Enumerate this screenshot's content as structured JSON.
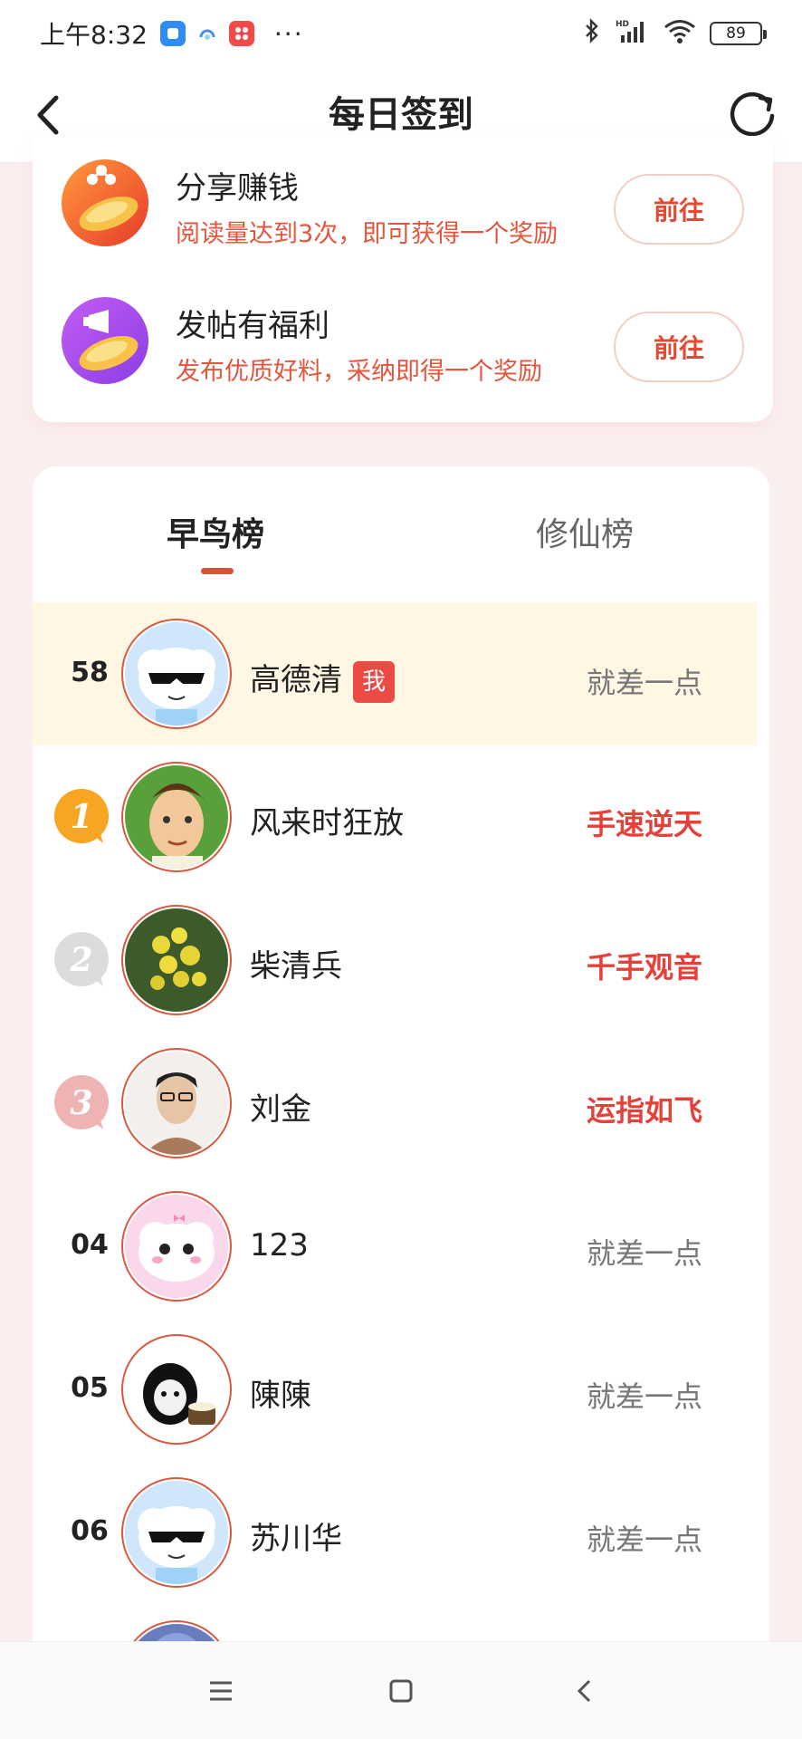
{
  "status_bar": {
    "time": "上午8:32",
    "battery": "89",
    "more": "···"
  },
  "header": {
    "title": "每日签到"
  },
  "tasks": [
    {
      "title": "分享赚钱",
      "desc": "阅读量达到3次，即可获得一个奖励",
      "button": "前往",
      "icon": "share-coin-icon"
    },
    {
      "title": "发帖有福利",
      "desc": "发布优质好料，采纳即得一个奖励",
      "button": "前往",
      "icon": "post-coin-icon"
    }
  ],
  "leaderboard": {
    "tabs": [
      "早鸟榜",
      "修仙榜"
    ],
    "active_tab": "早鸟榜",
    "me_badge": "我",
    "rows": [
      {
        "rank": "58",
        "name": "高德清",
        "tag": "就差一点",
        "is_me": true,
        "highlight": false
      },
      {
        "rank": "1",
        "name": "风来时狂放",
        "tag": "手速逆天",
        "is_me": false,
        "highlight": true
      },
      {
        "rank": "2",
        "name": "柴清兵",
        "tag": "千手观音",
        "is_me": false,
        "highlight": true
      },
      {
        "rank": "3",
        "name": "刘金",
        "tag": "运指如飞",
        "is_me": false,
        "highlight": true
      },
      {
        "rank": "04",
        "name": "123",
        "tag": "就差一点",
        "is_me": false,
        "highlight": false
      },
      {
        "rank": "05",
        "name": "陳陳",
        "tag": "就差一点",
        "is_me": false,
        "highlight": false
      },
      {
        "rank": "06",
        "name": "苏川华",
        "tag": "就差一点",
        "is_me": false,
        "highlight": false
      }
    ]
  },
  "colors": {
    "accent": "#e64a3a",
    "page_bg": "#fbeeee",
    "me_row_bg": "#fff7e4",
    "gold": "#f6a623",
    "silver": "#d6d6d6",
    "bronze": "#eeb3b3"
  }
}
